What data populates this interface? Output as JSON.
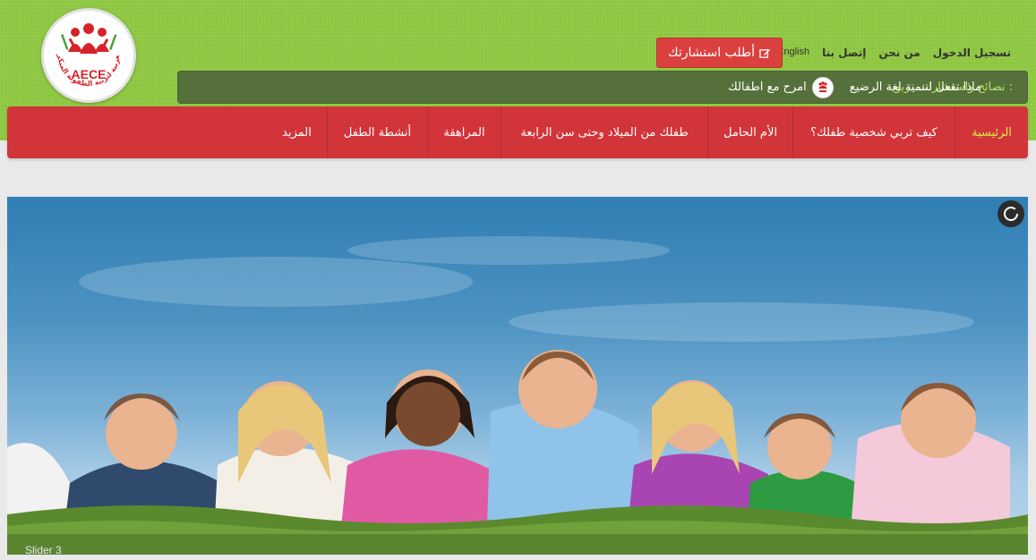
{
  "logo": {
    "text": "AECE",
    "arc_text": "العربية لتربية الطفولة المبكرة"
  },
  "top_links": [
    {
      "label": "تسجيل الدخول"
    },
    {
      "label": "من نحن"
    },
    {
      "label": "إتصل بنا"
    },
    {
      "label": "English"
    }
  ],
  "consult_button": {
    "label": "أطلب استشارتك",
    "icon": "edit-icon"
  },
  "ticker": {
    "label": "نصائح واستشارات تربوية :",
    "item_left": "امرح مع اطفالك",
    "item_right": "ماذا تفعل لتنمية لغة الرضيع"
  },
  "nav": [
    {
      "label": "الرئيسية",
      "active": true
    },
    {
      "label": "كيف تربي شخصية طفلك؟"
    },
    {
      "label": "الأم الحامل"
    },
    {
      "label": "طفلك من الميلاد وحتى سن الرابعة"
    },
    {
      "label": "المراهقة"
    },
    {
      "label": "أنشطة الطفل"
    },
    {
      "label": "المزيد"
    }
  ],
  "slider": {
    "caption": "Slider 3"
  },
  "colors": {
    "header_green": "#8dc63f",
    "nav_red": "#d1353a",
    "active_nav": "#d6f04a",
    "ticker_bg": "#55703a"
  }
}
